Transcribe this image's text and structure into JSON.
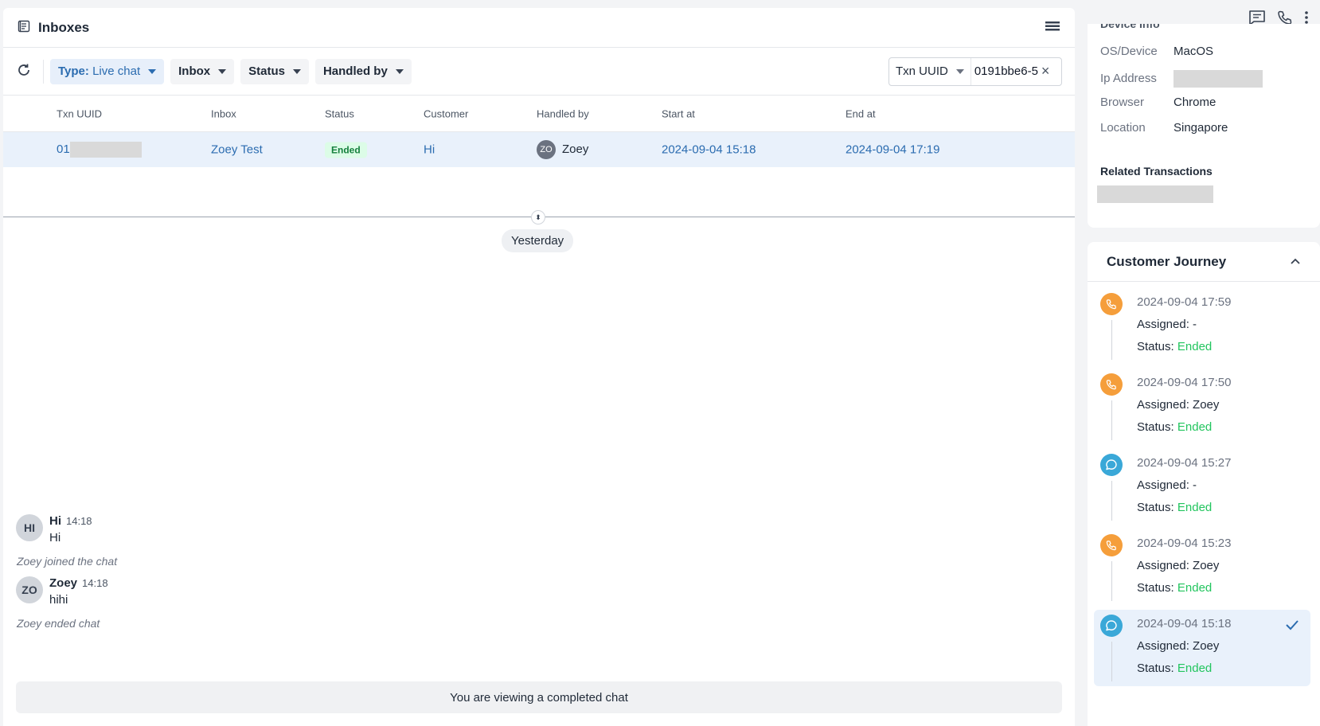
{
  "header": {
    "title": "Inboxes"
  },
  "filters": {
    "type_label": "Type:",
    "type_value": "Live chat",
    "inbox": "Inbox",
    "status": "Status",
    "handled_by": "Handled by"
  },
  "search": {
    "field": "Txn UUID",
    "value": "0191bbe6-5"
  },
  "table": {
    "columns": [
      "Txn UUID",
      "Inbox",
      "Status",
      "Customer",
      "Handled by",
      "Start at",
      "End at"
    ],
    "row": {
      "txn_prefix": "01",
      "inbox": "Zoey Test",
      "status": "Ended",
      "customer": "Hi",
      "handler_initials": "ZO",
      "handler": "Zoey",
      "start": "2024-09-04 15:18",
      "end": "2024-09-04 17:19"
    }
  },
  "chat": {
    "day": "Yesterday",
    "messages": [
      {
        "initials": "HI",
        "name": "Hi",
        "time": "14:18",
        "text": "Hi"
      },
      {
        "initials": "ZO",
        "name": "Zoey",
        "time": "14:18",
        "text": "hihi"
      }
    ],
    "system": [
      "Zoey joined the chat",
      "Zoey ended chat"
    ],
    "completed": "You are viewing a completed chat"
  },
  "device": {
    "heading": "Device Info",
    "rows": [
      {
        "key": "OS/Device",
        "value": "MacOS"
      },
      {
        "key": "Ip Address",
        "value": ""
      },
      {
        "key": "Browser",
        "value": "Chrome"
      },
      {
        "key": "Location",
        "value": "Singapore"
      }
    ],
    "related": "Related Transactions"
  },
  "journey": {
    "title": "Customer Journey",
    "assigned_label": "Assigned:",
    "status_label": "Status:",
    "items": [
      {
        "type": "call",
        "time": "2024-09-04 17:59",
        "assigned": "-",
        "status": "Ended"
      },
      {
        "type": "call",
        "time": "2024-09-04 17:50",
        "assigned": "Zoey",
        "status": "Ended"
      },
      {
        "type": "chat",
        "time": "2024-09-04 15:27",
        "assigned": "-",
        "status": "Ended"
      },
      {
        "type": "call",
        "time": "2024-09-04 15:23",
        "assigned": "Zoey",
        "status": "Ended"
      },
      {
        "type": "chat",
        "time": "2024-09-04 15:18",
        "assigned": "Zoey",
        "status": "Ended",
        "selected": true
      }
    ]
  },
  "colors": {
    "accent": "#2b6cb0",
    "call": "#f59e3b",
    "chat": "#3aa8d8",
    "ended": "#22c55e"
  }
}
